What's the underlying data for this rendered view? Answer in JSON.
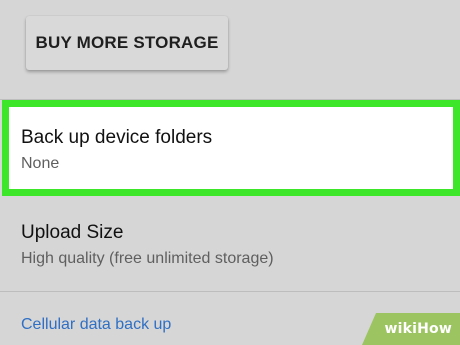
{
  "buttons": {
    "buy_more_storage": "BUY MORE STORAGE"
  },
  "settings": {
    "backup_device_folders": {
      "title": "Back up device folders",
      "value": "None"
    },
    "upload_size": {
      "title": "Upload Size",
      "value": "High quality (free unlimited storage)"
    },
    "cellular_backup": {
      "label": "Cellular data back up"
    }
  },
  "watermark": {
    "wiki": "wiki",
    "how": "How"
  },
  "colors": {
    "background": "#d6d6d6",
    "highlight_border": "#3ee62a",
    "link": "#2f6fc4"
  }
}
